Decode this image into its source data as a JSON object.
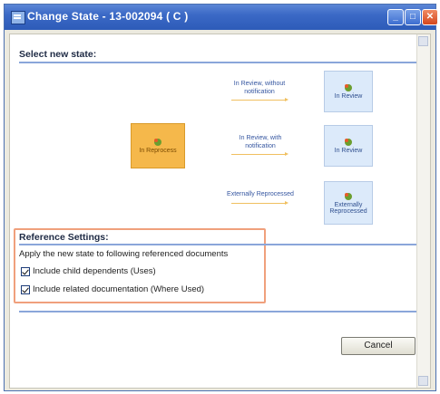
{
  "window": {
    "title": "Change State - 13-002094 ( C )",
    "accent_color": "#3b69c6",
    "close_color": "#d4471e"
  },
  "select_state": {
    "heading": "Select new state:",
    "current_state": {
      "label": "In Reprocess",
      "icon": "lifecycle-state-icon"
    },
    "transitions": [
      {
        "label_line1": "In Review, without",
        "label_line2": "notification",
        "target": "In Review"
      },
      {
        "label_line1": "In Review, with",
        "label_line2": "notification",
        "target": "In Review"
      },
      {
        "label_line1": "Externally Reprocessed",
        "label_line2": "",
        "target_line1": "Externally",
        "target_line2": "Reprocessed"
      }
    ]
  },
  "reference_settings": {
    "heading": "Reference Settings:",
    "apply_text": "Apply the new state to following referenced documents",
    "options": [
      {
        "label": "Include child dependents (Uses)",
        "checked": true
      },
      {
        "label": "Include related documentation (Where Used)",
        "checked": true
      }
    ]
  },
  "footer": {
    "cancel_label": "Cancel"
  }
}
